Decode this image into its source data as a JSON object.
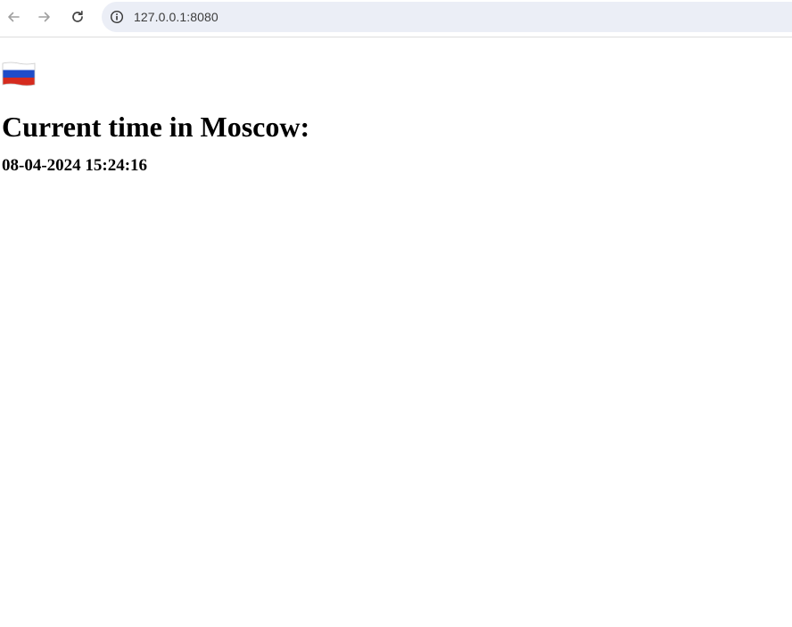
{
  "browser": {
    "url": "127.0.0.1:8080"
  },
  "page": {
    "flag_icon": "russia-flag-icon",
    "heading": "Current time in Moscow:",
    "time": "08-04-2024 15:24:16"
  },
  "colors": {
    "omnibox_bg": "#ebeef6",
    "flag_white": "#ffffff",
    "flag_blue": "#1f4cc8",
    "flag_red": "#d52b1e"
  }
}
